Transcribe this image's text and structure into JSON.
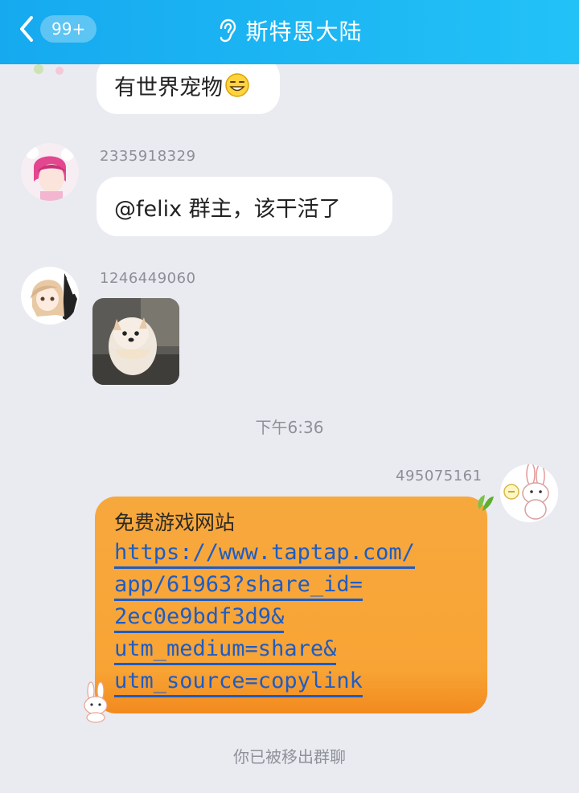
{
  "header": {
    "unread_badge": "99+",
    "title": "斯特恩大陆"
  },
  "messages": [
    {
      "sender": "",
      "text": "有世界宠物",
      "emoji": "grin-emoji-icon"
    },
    {
      "sender": "2335918329",
      "text": "@felix  群主，该干活了"
    },
    {
      "sender": "1246449060",
      "image": "puppy-photo"
    }
  ],
  "timestamp": "下午6:36",
  "my_message": {
    "sender": "495075161",
    "heading": "免费游戏网站",
    "link_lines": [
      "https://www.taptap.com/",
      "app/61963?share_id=",
      "2ec0e9bdf3d9&",
      "utm_medium=share&",
      "utm_source=copylink"
    ]
  },
  "system_notice": "你已被移出群聊",
  "colors": {
    "header_start": "#16a9ef",
    "header_end": "#22c2f7",
    "background": "#e9ebf1",
    "orange_bubble": "#f7a83d",
    "link": "#1e5cc4"
  }
}
